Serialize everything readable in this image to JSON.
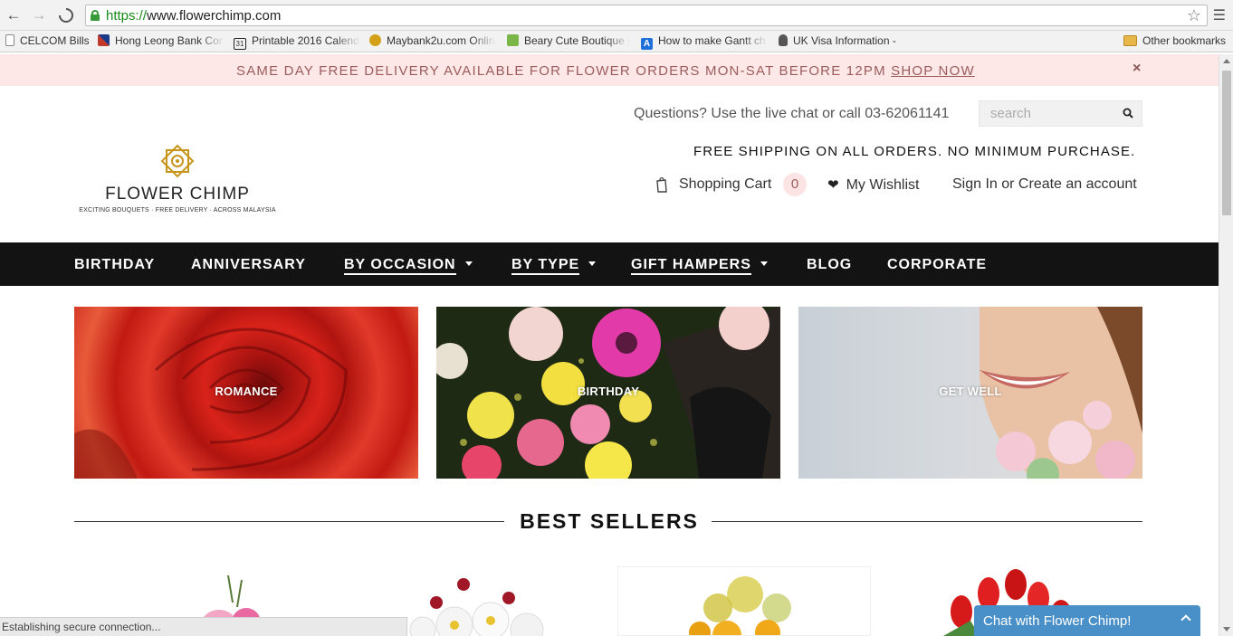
{
  "browser": {
    "url_protocol": "https://",
    "url_host": "www.flowerchimp.com",
    "back_icon": "back-arrow-icon",
    "forward_icon": "forward-arrow-icon",
    "reload_icon": "loading-icon"
  },
  "bookmarks": {
    "items": [
      {
        "label": "CELCOM Bills",
        "icon": "page-icon",
        "color": "#888888"
      },
      {
        "label": "Hong Leong Bank Cor",
        "icon": "flag-icon",
        "color": "#c0392b"
      },
      {
        "label": "Printable 2016 Calend",
        "icon": "calendar-icon",
        "color": "#222222"
      },
      {
        "label": "Maybank2u.com Onlin",
        "icon": "maybank-icon",
        "color": "#d4a017"
      },
      {
        "label": "Beary Cute Boutique |",
        "icon": "shopify-icon",
        "color": "#7ab648"
      },
      {
        "label": "How to make Gantt ch",
        "icon": "a-icon",
        "color": "#1e6fd9"
      },
      {
        "label": "UK Visa Information -",
        "icon": "crest-icon",
        "color": "#555555"
      }
    ],
    "other": "Other bookmarks"
  },
  "promo": {
    "text": "SAME DAY FREE DELIVERY AVAILABLE FOR FLOWER ORDERS MON-SAT BEFORE 12PM",
    "link": "SHOP NOW",
    "close": "×"
  },
  "header": {
    "logo_name": "FLOWER CHIMP",
    "logo_tagline": "EXCITING BOUQUETS · FREE DELIVERY · ACROSS MALAYSIA",
    "questions": "Questions? Use the live chat or call 03-62061141",
    "search_placeholder": "search",
    "free_shipping": "FREE SHIPPING ON ALL ORDERS. NO MINIMUM PURCHASE.",
    "cart_label": "Shopping Cart",
    "cart_count": "0",
    "wishlist_label": "My Wishlist",
    "signin_label": "Sign In or Create an account"
  },
  "nav": {
    "items": [
      {
        "label": "BIRTHDAY",
        "dropdown": false
      },
      {
        "label": "ANNIVERSARY",
        "dropdown": false
      },
      {
        "label": "BY OCCASION",
        "dropdown": true
      },
      {
        "label": "BY TYPE",
        "dropdown": true
      },
      {
        "label": "GIFT HAMPERS",
        "dropdown": true
      },
      {
        "label": "BLOG",
        "dropdown": false
      },
      {
        "label": "CORPORATE",
        "dropdown": false
      }
    ]
  },
  "tiles": [
    {
      "label": "ROMANCE"
    },
    {
      "label": "BIRTHDAY"
    },
    {
      "label": "GET WELL"
    }
  ],
  "best_sellers": {
    "title": "BEST SELLERS"
  },
  "status": {
    "text": "Establishing secure connection..."
  },
  "chat": {
    "label": "Chat with Flower Chimp!"
  },
  "colors": {
    "promo_bg": "#fde7e7",
    "promo_text": "#9b5d5d",
    "nav_bg": "#131313",
    "chat_bg": "#4a90c8",
    "logo_gold": "#c8951c"
  }
}
